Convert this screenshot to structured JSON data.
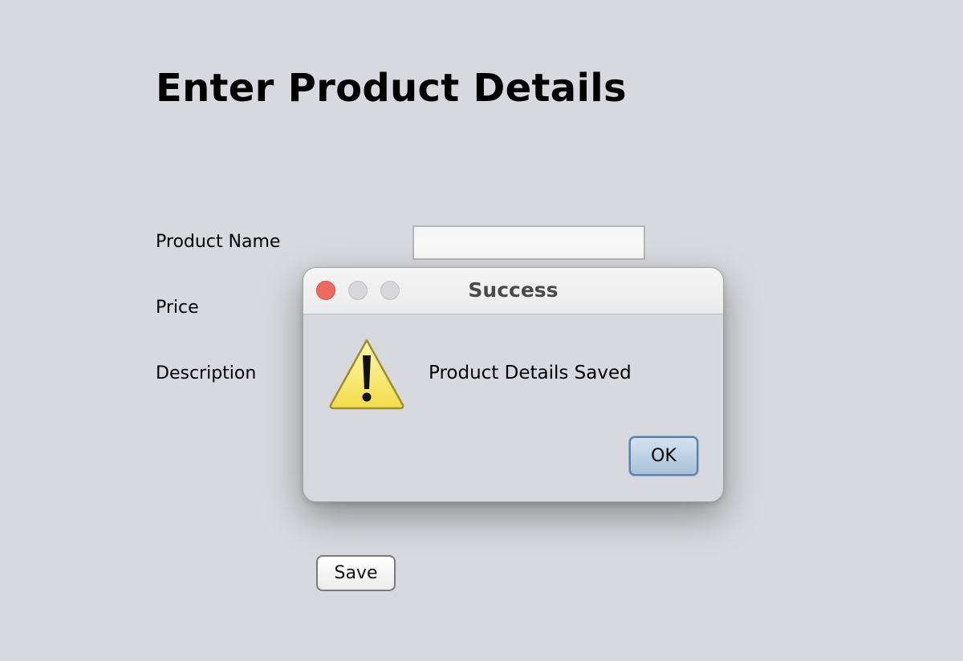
{
  "page": {
    "title": "Enter Product Details"
  },
  "form": {
    "product_name_label": "Product Name",
    "product_name_value": "",
    "price_label": "Price",
    "description_label": "Description",
    "save_label": "Save"
  },
  "dialog": {
    "title": "Success",
    "message": "Product Details Saved",
    "ok_label": "OK",
    "icon": "warning-icon"
  },
  "colors": {
    "background": "#d8d9de",
    "close_button": "#ee6a5f",
    "ok_button_accent": "#a9c1d8"
  }
}
